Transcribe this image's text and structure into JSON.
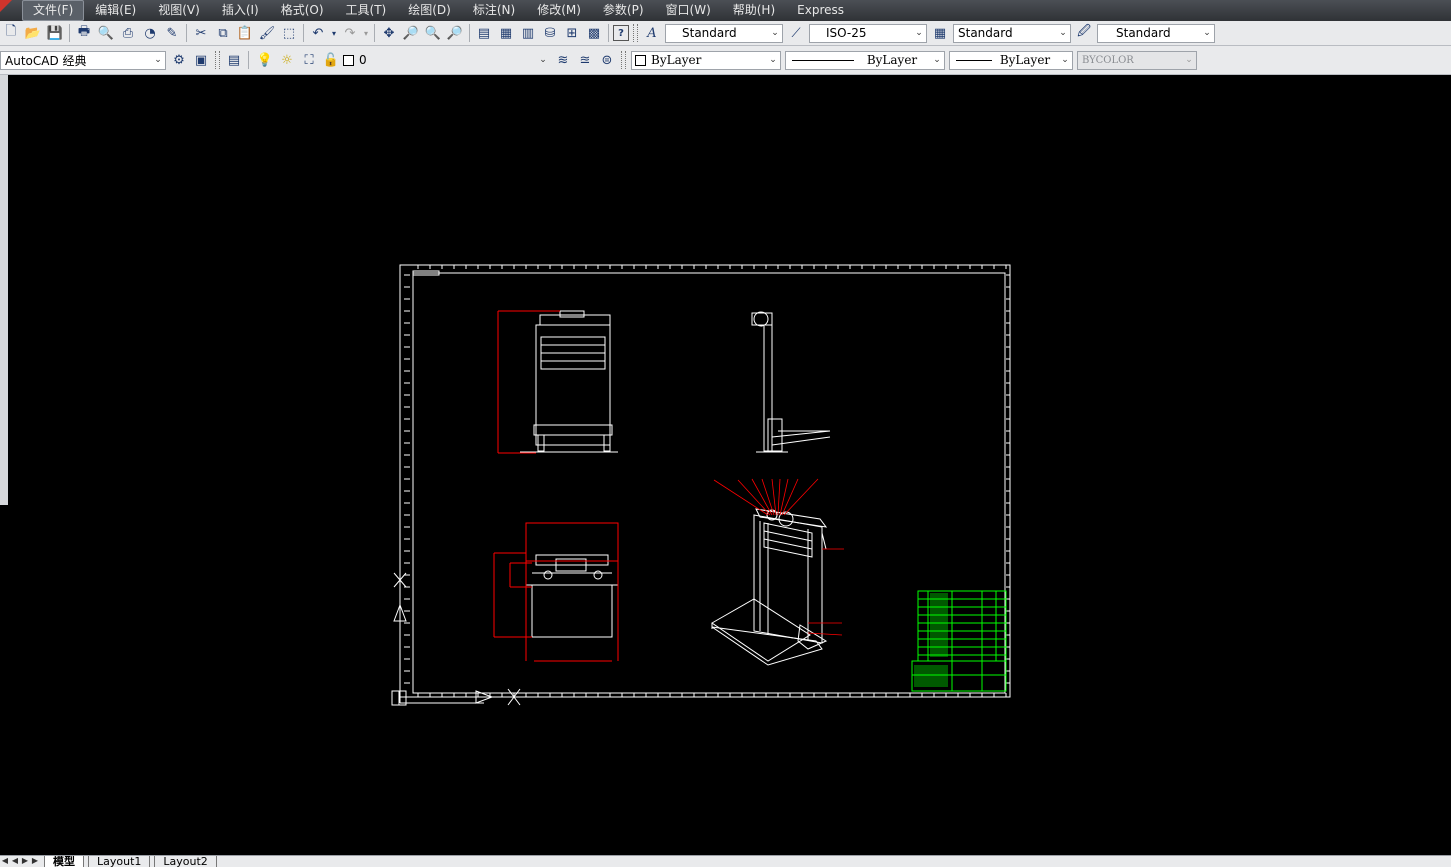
{
  "menu": {
    "items": [
      "文件(F)",
      "编辑(E)",
      "视图(V)",
      "插入(I)",
      "格式(O)",
      "工具(T)",
      "绘图(D)",
      "标注(N)",
      "修改(M)",
      "参数(P)",
      "窗口(W)",
      "帮助(H)",
      "Express"
    ]
  },
  "styles_toolbar": {
    "text_style": "Standard",
    "dim_style": "ISO-25",
    "table_style": "Standard",
    "multileader_style": "Standard"
  },
  "workspace": {
    "name": "AutoCAD 经典"
  },
  "layers": {
    "current_layer": "0"
  },
  "properties": {
    "color": "ByLayer",
    "linetype": "ByLayer",
    "lineweight": "ByLayer",
    "plot_style": "BYCOLOR"
  },
  "tabs": {
    "items": [
      "模型",
      "Layout1",
      "Layout2"
    ]
  },
  "colors": {
    "background": "#000000",
    "drawing_lines": "#ffffff",
    "dimension_lines": "#ff0000",
    "title_block": "#00ff00"
  }
}
